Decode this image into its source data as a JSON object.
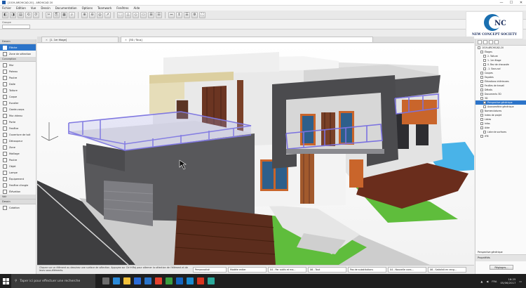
{
  "window": {
    "title": "[1019-ARCHICAD-20] - ARCHICAD 20",
    "controls": [
      "—",
      "☐",
      "✕"
    ]
  },
  "menu": [
    "Fichier",
    "Edition",
    "Vue",
    "Dessin",
    "Documentation",
    "Options",
    "Teamwork",
    "Fenêtres",
    "Aide"
  ],
  "group_label": "Groupe",
  "brand": {
    "name": "NEW CONCEPT SOCIETY",
    "mark": "NCS",
    "accent": "#1a6fb0"
  },
  "toolbox": {
    "sections": [
      {
        "label": "Dessin",
        "items": [
          "Flèche",
          "Zone de sélection"
        ]
      },
      {
        "label": "Conception",
        "items": [
          "Mur",
          "Poteau",
          "Poutre",
          "Dalle",
          "Toiture",
          "Coque",
          "Escalier",
          "Garde-corps",
          "Mur-rideau",
          "Porte",
          "Fenêtre",
          "Ouverture de toit",
          "Découpeur",
          "Zone",
          "Maillage",
          "Poutre",
          "Objet",
          "Lampe",
          "Équipement",
          "Fenêtre d'angle",
          "Élévation"
        ]
      },
      {
        "label": "Voir",
        "items": []
      },
      {
        "label": "Dessin",
        "items": [
          "Cotation"
        ]
      }
    ]
  },
  "tabs": [
    {
      "label": "[1. 1er étage]",
      "active": false
    },
    {
      "label": "[3D / Tous]",
      "active": true
    }
  ],
  "navigator": {
    "items": [
      {
        "label": "1019-ARCHICAD-20",
        "level": 0,
        "selected": false
      },
      {
        "label": "Étages",
        "level": 1,
        "selected": false
      },
      {
        "label": "2. Toiture",
        "level": 2,
        "selected": false
      },
      {
        "label": "1. 1er étage",
        "level": 2,
        "selected": false
      },
      {
        "label": "0. Rez de chaussée",
        "level": 2,
        "selected": false
      },
      {
        "label": "-1. Sous-sol",
        "level": 2,
        "selected": false
      },
      {
        "label": "Coupes",
        "level": 1,
        "selected": false
      },
      {
        "label": "Façades",
        "level": 1,
        "selected": false
      },
      {
        "label": "Élévations intérieures",
        "level": 1,
        "selected": false
      },
      {
        "label": "Feuilles de travail",
        "level": 1,
        "selected": false
      },
      {
        "label": "Détails",
        "level": 1,
        "selected": false
      },
      {
        "label": "Documents 3D",
        "level": 1,
        "selected": false
      },
      {
        "label": "3D",
        "level": 1,
        "selected": false
      },
      {
        "label": "Perspective générique",
        "level": 2,
        "selected": true
      },
      {
        "label": "Axonométrie générique",
        "level": 2,
        "selected": false
      },
      {
        "label": "Nomenclatures",
        "level": 1,
        "selected": false
      },
      {
        "label": "Index de projet",
        "level": 1,
        "selected": false
      },
      {
        "label": "Listes",
        "level": 1,
        "selected": false
      },
      {
        "label": "Infos",
        "level": 1,
        "selected": false
      },
      {
        "label": "Aide",
        "level": 1,
        "selected": false
      },
      {
        "label": "Liste de surfaces",
        "level": 2,
        "selected": false
      },
      {
        "label": "IFM",
        "level": 1,
        "selected": false
      }
    ],
    "properties_label": "Propriétés",
    "properties_value": "Perspective générique",
    "settings_button": "Réglages..."
  },
  "status": {
    "message": "Cliquez sur un élément ou dessinez une surface de sélection. Appuyez sur Ctrl+Maj pour alterner la sélection de l'élément et de leurs sous-éléments.",
    "dropdowns": [
      "Personnalisé",
      "Modèle entier",
      "04 - Par outils et ma...",
      "06 - Tout",
      "Pas de substitutions",
      "04 - Nouvelle cons...",
      "06 - Satisfait en rang..."
    ]
  },
  "taskbar": {
    "search_placeholder": "Taper ici pour effectuer une recherche",
    "apps": [
      {
        "name": "task-view",
        "color": "#6d6d6d"
      },
      {
        "name": "edge",
        "color": "#2b8ad8"
      },
      {
        "name": "explorer",
        "color": "#f2c13b"
      },
      {
        "name": "store",
        "color": "#2b6cd8"
      },
      {
        "name": "mail",
        "color": "#2a74c9"
      },
      {
        "name": "chrome",
        "color": "#e5422f"
      },
      {
        "name": "camtasia",
        "color": "#3a9f40"
      },
      {
        "name": "archicad",
        "color": "#1564c0"
      },
      {
        "name": "archicad-2",
        "color": "#1a8bd0"
      },
      {
        "name": "app-red",
        "color": "#d8341e"
      },
      {
        "name": "app-teal",
        "color": "#2aa99a"
      }
    ],
    "language": "FRA",
    "time": "16:25",
    "date": "05/06/2017"
  }
}
